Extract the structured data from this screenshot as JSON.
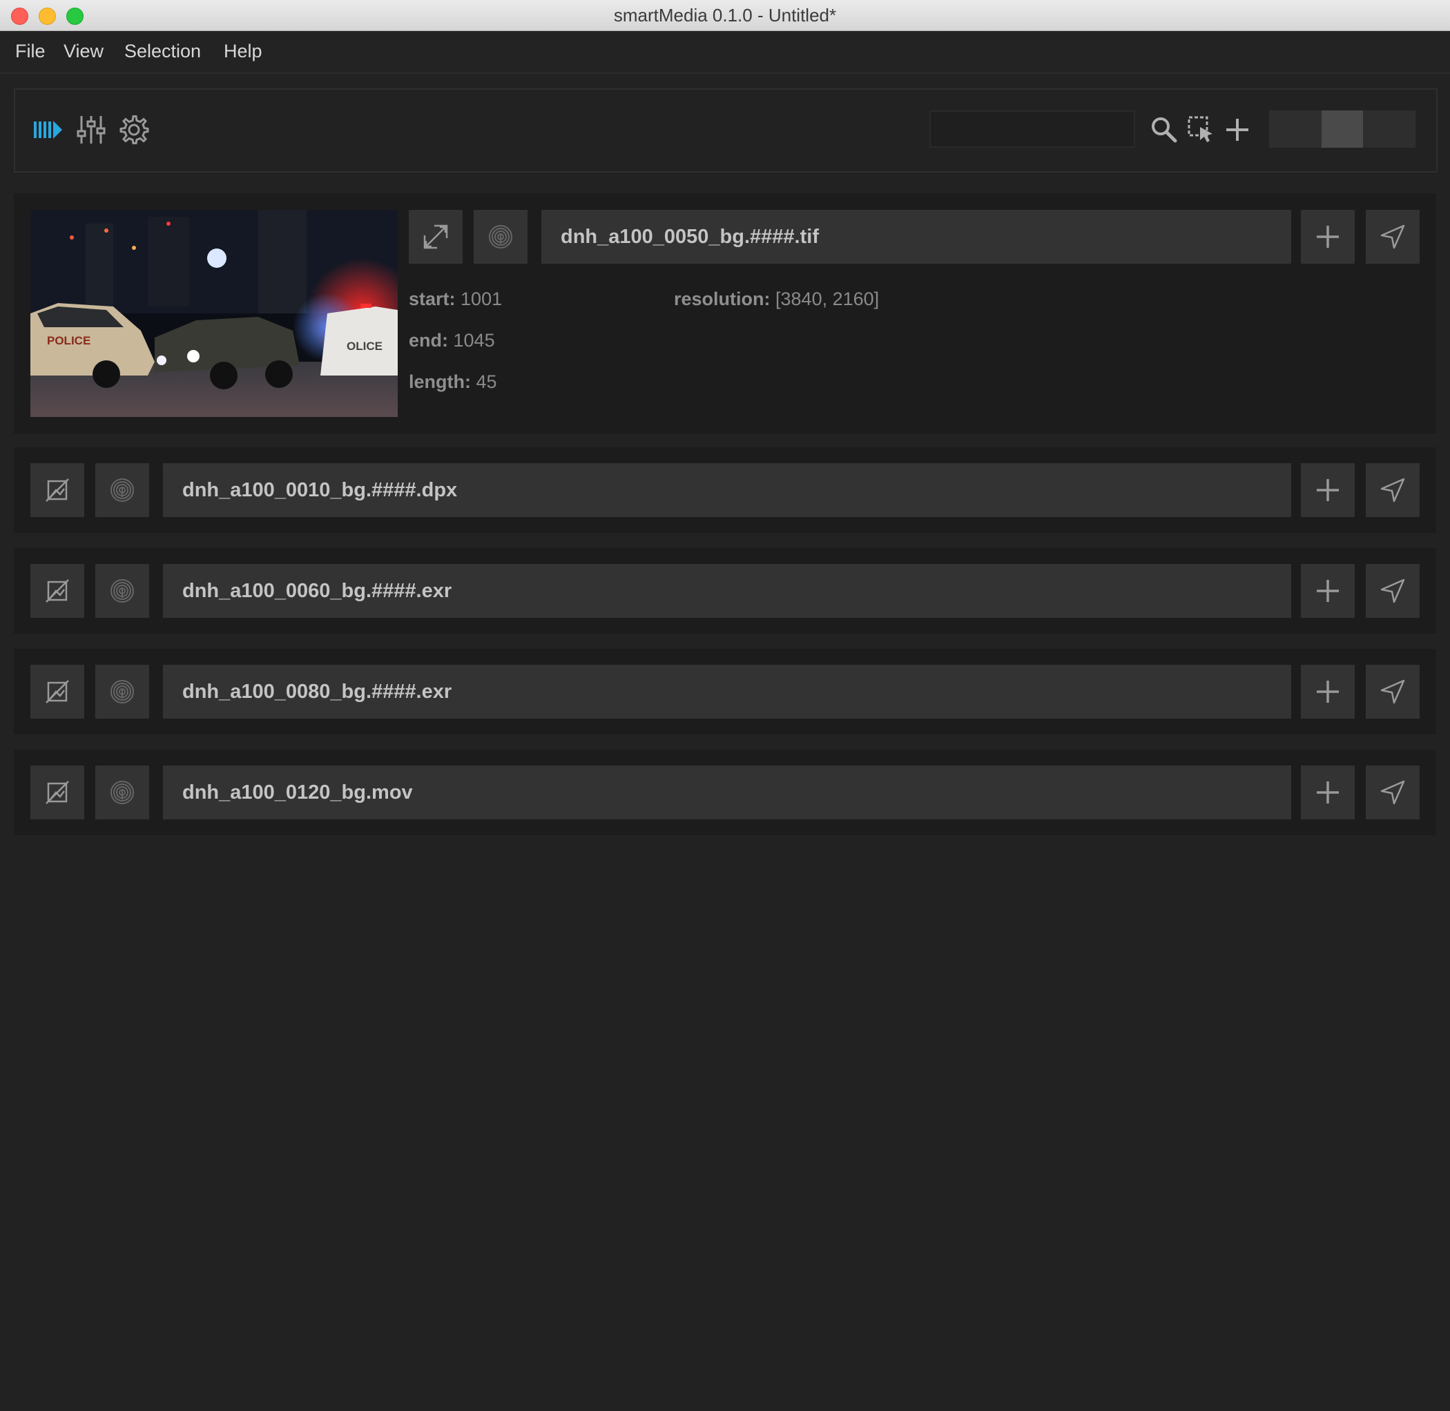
{
  "window": {
    "title": "smartMedia 0.1.0 - Untitled*"
  },
  "menu": [
    "File",
    "View",
    "Selection",
    "Help"
  ],
  "toolbar": {
    "left_icons": [
      "media-play-icon",
      "sliders-icon",
      "gear-icon"
    ],
    "search": {
      "value": "",
      "placeholder": ""
    },
    "right_icons": [
      "search-icon",
      "select-region-icon",
      "plus-icon"
    ]
  },
  "expanded_item": {
    "filename": "dnh_a100_0050_bg.####.tif",
    "thumbnail_text": [
      "POLICE",
      "OLICE"
    ],
    "meta": {
      "start_label": "start:",
      "start_value": "1001",
      "end_label": "end:",
      "end_value": "1045",
      "length_label": "length:",
      "length_value": "45",
      "resolution_label": "resolution:",
      "resolution_value": "[3840, 2160]"
    }
  },
  "items": [
    {
      "filename": "dnh_a100_0010_bg.####.dpx"
    },
    {
      "filename": "dnh_a100_0060_bg.####.exr"
    },
    {
      "filename": "dnh_a100_0080_bg.####.exr"
    },
    {
      "filename": "dnh_a100_0120_bg.mov"
    }
  ],
  "colors": {
    "accent": "#29a8e0",
    "background": "#222222",
    "row": "#1c1c1c",
    "field": "#333333"
  }
}
